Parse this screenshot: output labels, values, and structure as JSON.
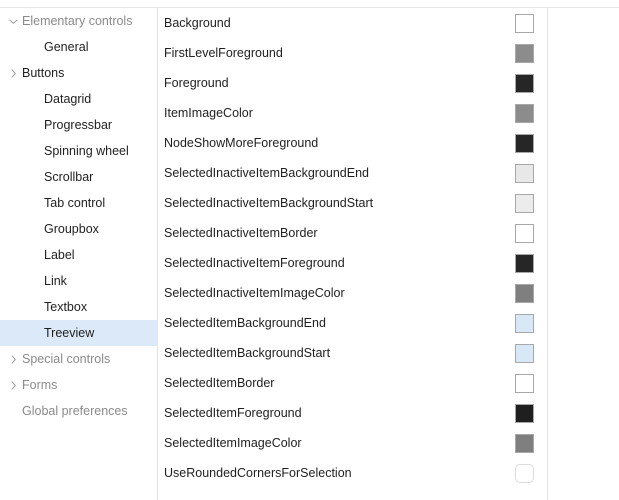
{
  "sidebar": {
    "items": [
      {
        "label": "Elementary controls",
        "level": 0,
        "twisty": "chevron-down-icon",
        "selected": false,
        "muted": true
      },
      {
        "label": "General",
        "level": 1,
        "twisty": "none",
        "selected": false,
        "muted": false
      },
      {
        "label": "Buttons",
        "level": 1,
        "twisty": "chevron-right-icon",
        "selected": false,
        "muted": false
      },
      {
        "label": "Datagrid",
        "level": 1,
        "twisty": "none",
        "selected": false,
        "muted": false
      },
      {
        "label": "Progressbar",
        "level": 1,
        "twisty": "none",
        "selected": false,
        "muted": false
      },
      {
        "label": "Spinning wheel",
        "level": 1,
        "twisty": "none",
        "selected": false,
        "muted": false
      },
      {
        "label": "Scrollbar",
        "level": 1,
        "twisty": "none",
        "selected": false,
        "muted": false
      },
      {
        "label": "Tab control",
        "level": 1,
        "twisty": "none",
        "selected": false,
        "muted": false
      },
      {
        "label": "Groupbox",
        "level": 1,
        "twisty": "none",
        "selected": false,
        "muted": false
      },
      {
        "label": "Label",
        "level": 1,
        "twisty": "none",
        "selected": false,
        "muted": false
      },
      {
        "label": "Link",
        "level": 1,
        "twisty": "none",
        "selected": false,
        "muted": false
      },
      {
        "label": "Textbox",
        "level": 1,
        "twisty": "none",
        "selected": false,
        "muted": false
      },
      {
        "label": "Treeview",
        "level": 1,
        "twisty": "none",
        "selected": true,
        "muted": false
      },
      {
        "label": "Special controls",
        "level": 0,
        "twisty": "chevron-right-icon",
        "selected": false,
        "muted": true
      },
      {
        "label": "Forms",
        "level": 0,
        "twisty": "chevron-right-icon",
        "selected": false,
        "muted": true
      },
      {
        "label": "Global preferences",
        "level": 0,
        "twisty": "none",
        "selected": false,
        "muted": true
      }
    ],
    "selection_color": "#dbe9f8"
  },
  "properties": [
    {
      "name": "Background",
      "type": "color",
      "value": "#ffffff"
    },
    {
      "name": "FirstLevelForeground",
      "type": "color",
      "value": "#8c8c8c"
    },
    {
      "name": "Foreground",
      "type": "color",
      "value": "#262626"
    },
    {
      "name": "ItemImageColor",
      "type": "color",
      "value": "#8c8c8c"
    },
    {
      "name": "NodeShowMoreForeground",
      "type": "color",
      "value": "#262626"
    },
    {
      "name": "SelectedInactiveItemBackgroundEnd",
      "type": "color",
      "value": "#e8e8e8"
    },
    {
      "name": "SelectedInactiveItemBackgroundStart",
      "type": "color",
      "value": "#ececec"
    },
    {
      "name": "SelectedInactiveItemBorder",
      "type": "color",
      "value": "#ffffff"
    },
    {
      "name": "SelectedInactiveItemForeground",
      "type": "color",
      "value": "#262626"
    },
    {
      "name": "SelectedInactiveItemImageColor",
      "type": "color",
      "value": "#7f7f7f"
    },
    {
      "name": "SelectedItemBackgroundEnd",
      "type": "color",
      "value": "#d9e8f7"
    },
    {
      "name": "SelectedItemBackgroundStart",
      "type": "color",
      "value": "#d9e8f7"
    },
    {
      "name": "SelectedItemBorder",
      "type": "color",
      "value": "#ffffff"
    },
    {
      "name": "SelectedItemForeground",
      "type": "color",
      "value": "#1f1f1f"
    },
    {
      "name": "SelectedItemImageColor",
      "type": "color",
      "value": "#7f7f7f"
    },
    {
      "name": "UseRoundedCornersForSelection",
      "type": "checkbox",
      "value": "unchecked"
    }
  ]
}
